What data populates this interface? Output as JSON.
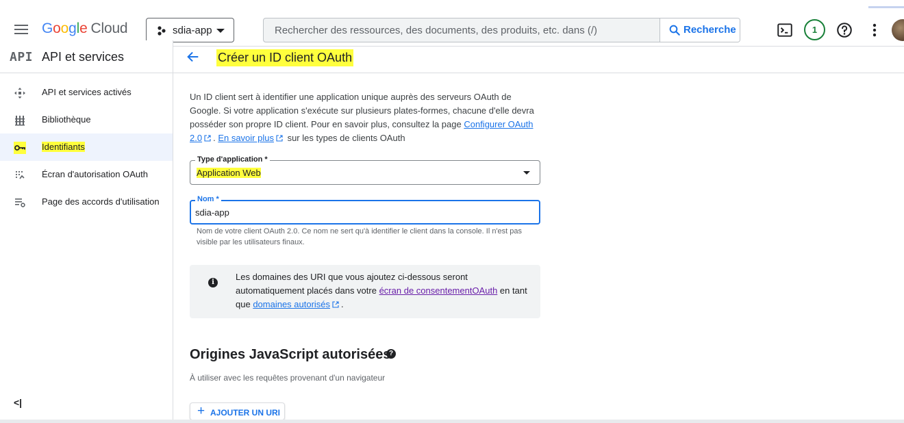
{
  "topbar": {
    "logo_google": "Google",
    "logo_cloud": "Cloud",
    "project": "sdia-app",
    "search_placeholder": "Rechercher des ressources, des documents, des produits, etc. dans (/)",
    "search_button": "Recherche",
    "notification_count": "1"
  },
  "sidebar": {
    "logo": "API",
    "title": "API et services",
    "items": [
      {
        "label": "API et services activés",
        "icon": "hub-icon"
      },
      {
        "label": "Bibliothèque",
        "icon": "library-icon"
      },
      {
        "label": "Identifiants",
        "icon": "key-icon"
      },
      {
        "label": "Écran d'autorisation OAuth",
        "icon": "oauth-consent-icon"
      },
      {
        "label": "Page des accords d'utilisation",
        "icon": "settings-list-icon"
      }
    ],
    "collapse_label": "<|"
  },
  "main": {
    "title": "Créer un ID client OAuth",
    "intro": {
      "text1": "Un ID client sert à identifier une application unique auprès des serveurs OAuth de Google. Si votre application s'exécute sur plusieurs plates-formes, chacune d'elle devra posséder son propre ID client. Pour en savoir plus, consultez la page ",
      "link1": "Configurer OAuth 2.0",
      "text2": ". ",
      "link2": "En savoir plus",
      "text3": " sur les types de clients OAuth"
    },
    "app_type": {
      "label": "Type d'application *",
      "value": "Application Web"
    },
    "name_field": {
      "label": "Nom *",
      "value": "sdia-app",
      "hint": "Nom de votre client OAuth 2.0. Ce nom ne sert qu'à identifier le client dans la console. Il n'est pas visible par les utilisateurs finaux."
    },
    "info": {
      "text1": "Les domaines des URI que vous ajoutez ci-dessous seront automatiquement placés dans votre ",
      "link1": "écran de consentementOAuth",
      "text2": " en tant que ",
      "link2": "domaines autorisés",
      "text3": "."
    },
    "js_origins": {
      "title": "Origines JavaScript autorisées",
      "subtitle": "À utiliser avec les requêtes provenant d'un navigateur",
      "add_button": "AJOUTER UN URI"
    }
  },
  "colors": {
    "accent": "#1a73e8",
    "highlight": "#ffff3d",
    "badge_green": "#188038"
  }
}
